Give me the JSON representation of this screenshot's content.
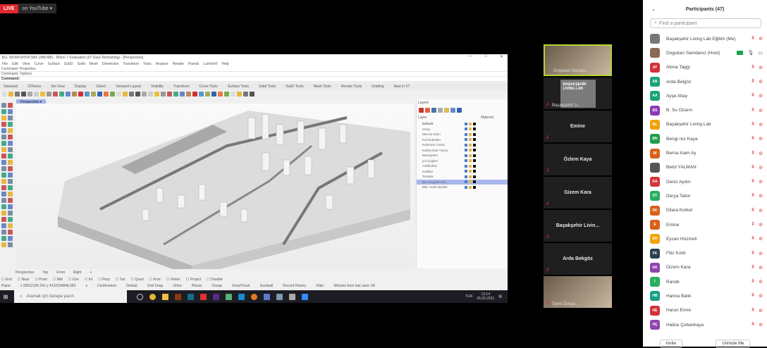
{
  "stream": {
    "live": "LIVE",
    "platform": "on YouTube ▾"
  },
  "rhino": {
    "title": "BLL WORKSHOP.3dm (388 MB) - Rhino 7 Evaluation (57 Days Remaining) - [Perspective]",
    "menu": [
      "File",
      "Edit",
      "View",
      "Curve",
      "Surface",
      "SubD",
      "Solid",
      "Mesh",
      "Dimension",
      "Transform",
      "Tools",
      "Analyze",
      "Render",
      "Panels",
      "Lumion®",
      "Help"
    ],
    "commands": [
      "Command: Properties",
      "Command: Options",
      "Command:"
    ],
    "toolbar_tabs": [
      "Standard",
      "CPlanes",
      "Set View",
      "Display",
      "Select",
      "Viewport Layout",
      "Visibility",
      "Transform",
      "Curve Tools",
      "Surface Tools",
      "Solid Tools",
      "SubD Tools",
      "Mesh Tools",
      "Render Tools",
      "Drafting",
      "New in V7"
    ],
    "viewport_tab": "Perspective ▾",
    "viewport_tabs": [
      "Perspective",
      "Top",
      "Front",
      "Right",
      "+"
    ],
    "snaps": [
      "End",
      "Near",
      "Point",
      "Mid",
      "Cen",
      "Int",
      "Perp",
      "Tan",
      "Quad",
      "Knot",
      "Vertex",
      "Project",
      "Disable"
    ],
    "status": [
      "Plane",
      "x 39912106.341 y 4122194846.082",
      "z",
      "Centimeters",
      "Default",
      "Grid Snap",
      "Ortho",
      "Planar",
      "Osnap",
      "SmartTrack",
      "Gumball",
      "Record History",
      "Filter",
      "Minutes from last save: 58"
    ],
    "layers_title": "Layers",
    "layers_header": [
      "Layer",
      "Material"
    ],
    "layers": [
      "Default",
      "Ozeg",
      "Mevcut Sinirı",
      "Kot Noktaları",
      "Referans Yüzey",
      "Kullanımlar Yüzey",
      "Belediyeler",
      "yol çizgileri",
      "Yol/Bloklar",
      "Kotlalar",
      "Teraslar",
      "BLL Dogalan Mo...",
      "BBL Yenili Meslek"
    ],
    "selected_layer": 11
  },
  "taskbar": {
    "search": "Aramak için buraya yazın",
    "lang": "TUR",
    "time": "13:14",
    "date": "26.05.2021"
  },
  "tiles": [
    {
      "name": "Dogukan Samda...",
      "video": true,
      "active": true
    },
    {
      "name": "Başakşehir Li...",
      "video": true,
      "logo": "BAŞAKŞEHİR LIVING LAB"
    },
    {
      "name": "Emine"
    },
    {
      "name": "Özlem Kaya"
    },
    {
      "name": "Gizem Kara"
    },
    {
      "name": "Başakşehir Livin..."
    },
    {
      "name": "Arda Bekgöz"
    },
    {
      "name": "Öykü Özkan...",
      "video": true
    }
  ],
  "participants": {
    "title": "Participants (47)",
    "search_placeholder": "Find a participant",
    "items": [
      {
        "initials": "",
        "name": "Başakşehir Living Lab Eğitim (Me)",
        "color": "#777777"
      },
      {
        "initials": "",
        "name": "Dogukan Samdanci (Host)",
        "color": "#8a6a55",
        "host": true
      },
      {
        "initials": "AT",
        "name": "Alona Taggı",
        "color": "#d13438"
      },
      {
        "initials": "AB",
        "name": "Arda Belgöz",
        "color": "#1aa37a"
      },
      {
        "initials": "AA",
        "name": "Ayşe Altay",
        "color": "#1aa37a"
      },
      {
        "initials": "BS",
        "name": "B. Su Ozarın",
        "color": "#8a3ab9"
      },
      {
        "initials": "BL",
        "name": "Başakşehir Living Lab",
        "color": "#f0a30a"
      },
      {
        "initials": "BN",
        "name": "Bengi nur Kaya",
        "color": "#1f9e4a"
      },
      {
        "initials": "Bİ",
        "name": "Berna İnam Ay",
        "color": "#d9601a"
      },
      {
        "initials": "",
        "name": "Betül YALMAN",
        "color": "#555555"
      },
      {
        "initials": "DA",
        "name": "Deniz Aydın",
        "color": "#d13438"
      },
      {
        "initials": "DT",
        "name": "Derya Tekin",
        "color": "#27ae60"
      },
      {
        "initials": "DK",
        "name": "Dilara Korkel",
        "color": "#d9601a"
      },
      {
        "initials": "E",
        "name": "Emine",
        "color": "#d9601a"
      },
      {
        "initials": "EH",
        "name": "Eycan Hüzmeli",
        "color": "#f0a30a"
      },
      {
        "initials": "FK",
        "name": "Filiz Kılıtlı",
        "color": "#2d3e50"
      },
      {
        "initials": "GK",
        "name": "Gizem Kara",
        "color": "#8e44ad"
      },
      {
        "initials": "İ",
        "name": "Randk",
        "color": "#27ae60"
      },
      {
        "initials": "HB",
        "name": "Hanna Balık",
        "color": "#16a085"
      },
      {
        "initials": "HE",
        "name": "Harun Emre",
        "color": "#d13438"
      },
      {
        "initials": "HÇ",
        "name": "Hatice Çobankaya",
        "color": "#8e44ad"
      }
    ],
    "invite": "Invite",
    "unmute": "Unmute Me"
  }
}
